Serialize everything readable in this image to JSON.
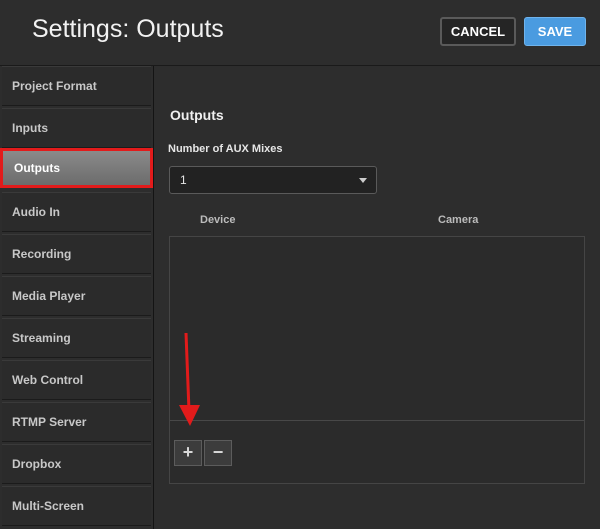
{
  "header": {
    "title": "Settings: Outputs",
    "cancel_label": "CANCEL",
    "save_label": "SAVE"
  },
  "sidebar": {
    "items": [
      {
        "label": "Project Format"
      },
      {
        "label": "Inputs"
      },
      {
        "label": "Outputs",
        "active": true
      },
      {
        "label": "Audio In"
      },
      {
        "label": "Recording"
      },
      {
        "label": "Media Player"
      },
      {
        "label": "Streaming"
      },
      {
        "label": "Web Control"
      },
      {
        "label": "RTMP Server"
      },
      {
        "label": "Dropbox"
      },
      {
        "label": "Multi-Screen"
      }
    ]
  },
  "main": {
    "section_title": "Outputs",
    "aux_label": "Number of AUX Mixes",
    "aux_value": "1",
    "columns": [
      "Device",
      "Camera"
    ],
    "add_label": "+",
    "remove_label": "−"
  },
  "colors": {
    "accent": "#4a9be0",
    "highlight": "#e21b1b",
    "background": "#2d2d2d"
  }
}
